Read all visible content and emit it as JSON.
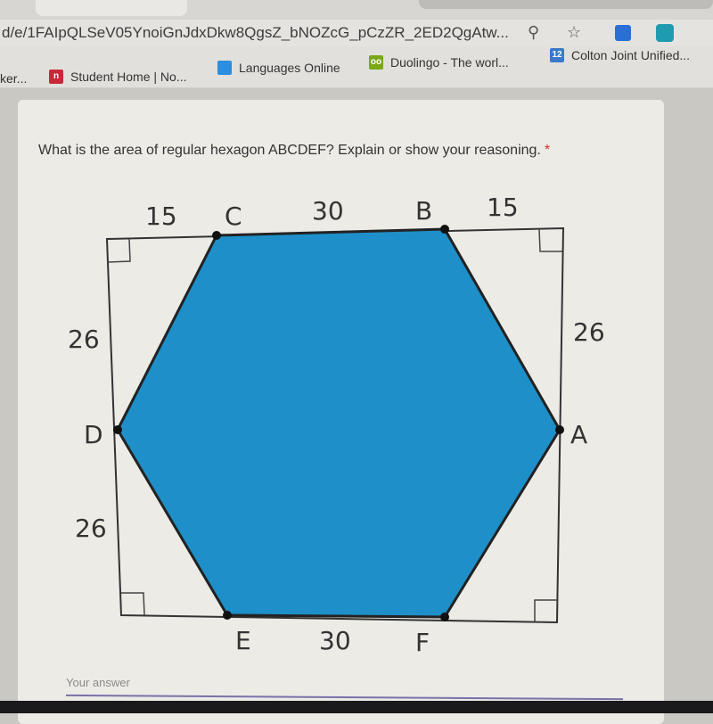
{
  "browser": {
    "url": "d/e/1FAIpQLSeV05YnoiGnJdxDkw8QgsZ_bNOZcG_pCzZR_2ED2QgAtw...",
    "icons": [
      "zoom-icon",
      "star-icon",
      "translate-extension-icon",
      "extension-icon"
    ],
    "bookmarks": [
      {
        "label": "ker...",
        "icon": "none"
      },
      {
        "label": "Student Home | No...",
        "icon": "student-home-icon",
        "color": "#c8283a"
      },
      {
        "label": "Languages Online",
        "icon": "chat-bubble-icon",
        "color": "#2b8ee0"
      },
      {
        "label": "Duolingo - The worl...",
        "icon": "duolingo-icon",
        "color": "#7aa818"
      },
      {
        "label": "Colton Joint Unified...",
        "icon": "calendar-icon",
        "color": "#3a78c8",
        "badge": "12"
      }
    ]
  },
  "question": {
    "text": "What is the area of regular hexagon ABCDEF? Explain or show your reasoning.",
    "required_mark": "*"
  },
  "figure": {
    "fill_color": "#1e8fc8",
    "vertices": [
      "A",
      "B",
      "C",
      "D",
      "E",
      "F"
    ],
    "labels": {
      "top_left": "15",
      "top_middle": "30",
      "top_right": "15",
      "left_upper": "26",
      "left_lower": "26",
      "right_upper": "26",
      "bottom_middle": "30"
    }
  },
  "answer": {
    "placeholder": "Your answer"
  }
}
